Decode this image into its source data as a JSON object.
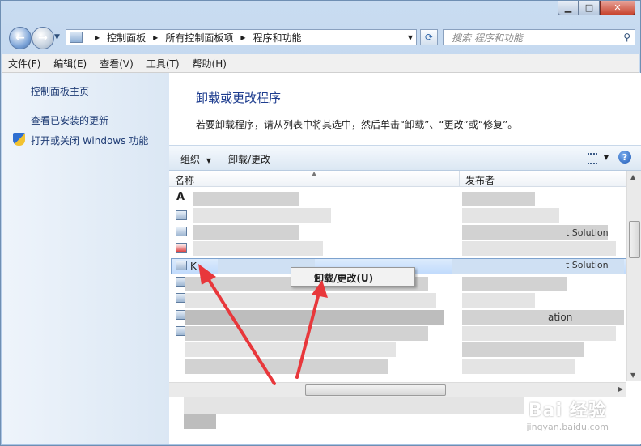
{
  "address": {
    "crumbs": [
      "控制面板",
      "所有控制面板项",
      "程序和功能"
    ]
  },
  "search": {
    "placeholder": "搜索 程序和功能"
  },
  "menu": [
    "文件(F)",
    "编辑(E)",
    "查看(V)",
    "工具(T)",
    "帮助(H)"
  ],
  "sidebar": {
    "links": [
      "控制面板主页",
      "查看已安装的更新",
      "打开或关闭 Windows 功能"
    ]
  },
  "main": {
    "heading": "卸载或更改程序",
    "description": "若要卸载程序，请从列表中将其选中，然后单击“卸载”、“更改”或“修复”。",
    "toolbar": {
      "organize": "组织",
      "uninstall_change": "卸载/更改"
    },
    "columns": {
      "name": "名称",
      "publisher": "发布者"
    },
    "row_fragments": {
      "selected_name_initial": "K",
      "publisher_partial_1": "t Solution",
      "publisher_partial_2": "t Solution",
      "publisher_partial_3": "ation"
    }
  },
  "context_menu": {
    "item": "卸载/更改(U)"
  },
  "watermark": {
    "brand": "Bai 经验",
    "url": "jingyan.baidu.com"
  },
  "colors": {
    "arrow": "#e8373b",
    "heading": "#1e3d8f",
    "link": "#1e3b74",
    "selection": "#c1dbfc"
  }
}
